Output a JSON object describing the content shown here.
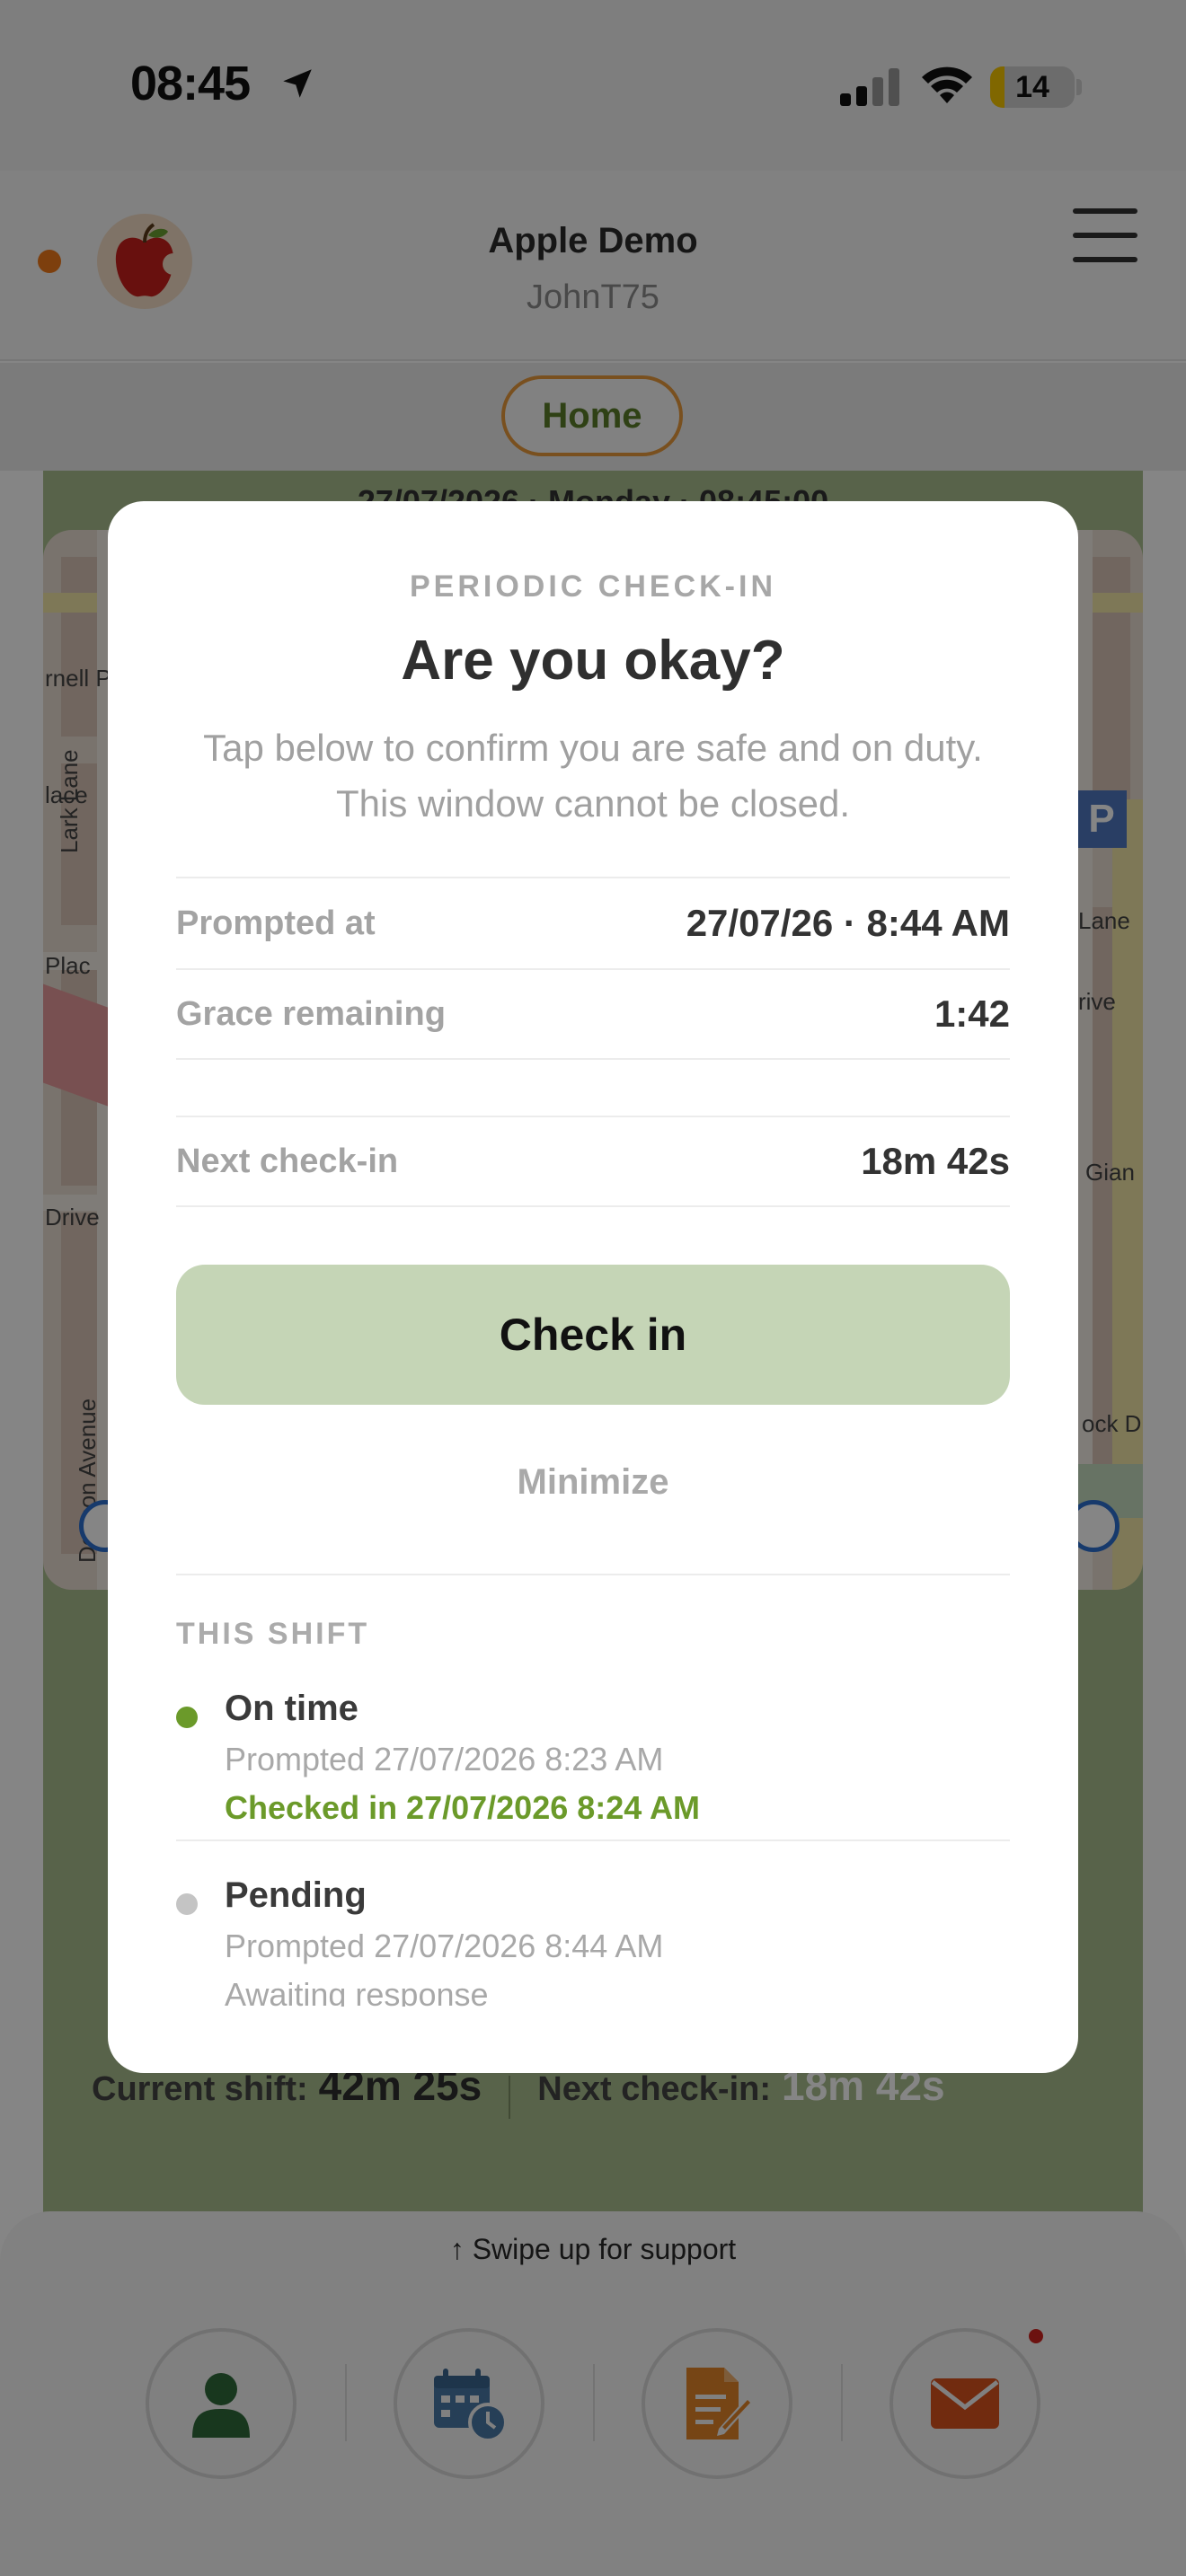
{
  "status_bar": {
    "time": "08:45",
    "battery": "14"
  },
  "header": {
    "org_name": "Apple Demo",
    "user_name": "JohnT75"
  },
  "nav": {
    "home_label": "Home"
  },
  "background": {
    "date_peek": "27/07/2026 · Monday · 08:45:00",
    "map_labels": [
      "Lark Lane",
      "Denson Avenue",
      "Drive",
      "Lane",
      "Gian",
      "ock D",
      "rive",
      "lace",
      "rnell P",
      "Plac"
    ],
    "stats": {
      "current_shift_label": "Current shift:",
      "current_shift_value": "42m 25s",
      "next_checkin_label": "Next check-in:",
      "next_checkin_value": "18m 42s"
    }
  },
  "modal": {
    "eyebrow": "PERIODIC CHECK-IN",
    "title": "Are you okay?",
    "description": "Tap below to confirm you are safe and on duty. This window cannot be closed.",
    "rows": [
      {
        "label": "Prompted at",
        "value": "27/07/26 · 8:44 AM"
      },
      {
        "label": "Grace remaining",
        "value": "1:42"
      },
      {
        "label": "Next check-in",
        "value": "18m 42s"
      }
    ],
    "checkin_label": "Check in",
    "minimize_label": "Minimize",
    "section_title": "THIS SHIFT",
    "history": [
      {
        "status": "On time",
        "prompted": "Prompted 27/07/2026 8:23 AM",
        "detail": "Checked in 27/07/2026 8:24 AM",
        "dot_color": "#6b9a2a",
        "detail_color": "#6b9a2a"
      },
      {
        "status": "Pending",
        "prompted": "Prompted 27/07/2026 8:44 AM",
        "detail": "Awaiting response",
        "dot_color": "#c4c4c4",
        "detail_color": "#a8a8a8"
      }
    ]
  },
  "bottom_sheet": {
    "swipe_hint": "↑ Swipe up for support",
    "tabs": [
      {
        "icon": "user-icon"
      },
      {
        "icon": "calendar-clock-icon"
      },
      {
        "icon": "document-edit-icon"
      },
      {
        "icon": "mail-icon"
      }
    ]
  },
  "colors": {
    "accent_green": "#6b9a2a",
    "checkin_button": "#c5d5b6",
    "home_outline": "#e89a3c",
    "presence": "#f07a1a",
    "notification": "#d0241f"
  }
}
